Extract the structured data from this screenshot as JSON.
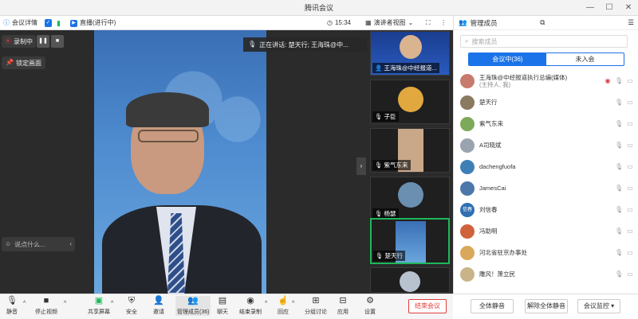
{
  "window": {
    "title": "腾讯会议"
  },
  "topbar": {
    "meeting_details": "会议详情",
    "live": "直播(进行中)",
    "time": "15:34",
    "view_mode": "演讲者视图"
  },
  "stage": {
    "recording_label": "录制中",
    "lock_label": "锁定画面",
    "speaking_text": "正在讲话: 楚天行; 王海珠@中...",
    "chat_placeholder": "说点什么..."
  },
  "thumbnails": [
    {
      "name": "王海珠@中经报道..."
    },
    {
      "name": "子臣"
    },
    {
      "name": "紫气东来"
    },
    {
      "name": "杨瑟"
    },
    {
      "name": "楚天行"
    },
    {
      "name": ""
    }
  ],
  "right_panel": {
    "title": "管理成员",
    "search_placeholder": "搜索成员",
    "tab_in_meeting": "会议中(36)",
    "tab_not_joined": "未入会",
    "participants": [
      {
        "name": "王海珠@中经报道执行总编(媒体)",
        "role": "(主持人, 我)",
        "avatar_color": "#c77b6e"
      },
      {
        "name": "楚天行",
        "role": "",
        "avatar_color": "#8a7a60"
      },
      {
        "name": "紫气东来",
        "role": "",
        "avatar_color": "#7caa5a"
      },
      {
        "name": "A司晓斌",
        "role": "",
        "avatar_color": "#9aa4b0"
      },
      {
        "name": "dachengfuofa",
        "role": "",
        "avatar_color": "#3f7fb8"
      },
      {
        "name": "JamesCai",
        "role": "",
        "avatar_color": "#4b78a8"
      },
      {
        "name": "刘信春",
        "role": "",
        "avatar_color": "#2f6fb2",
        "avatar_text": "信春"
      },
      {
        "name": "冯助明",
        "role": "",
        "avatar_color": "#d0613d"
      },
      {
        "name": "河北省驻京办事处",
        "role": "",
        "avatar_color": "#d9a85a"
      },
      {
        "name": "雕风！萧立民",
        "role": "",
        "avatar_color": "#c9b48a"
      }
    ],
    "mute_all": "全体静音",
    "unmute_all": "解除全体静音",
    "meeting_control": "会议监控"
  },
  "bottombar": {
    "mute": "静音",
    "stop_video": "停止视频",
    "share_screen": "共享屏幕",
    "security": "安全",
    "invite": "邀请",
    "manage_members": "管理成员(36)",
    "chat": "聊天",
    "end_recording": "结束录制",
    "reactions": "回应",
    "breakout": "分组讨论",
    "apps": "应用",
    "settings": "设置",
    "end_meeting": "结束会议"
  },
  "colors": {
    "accent": "#1a73e8",
    "danger": "#e03c3c",
    "active_border": "#1fb85a"
  }
}
